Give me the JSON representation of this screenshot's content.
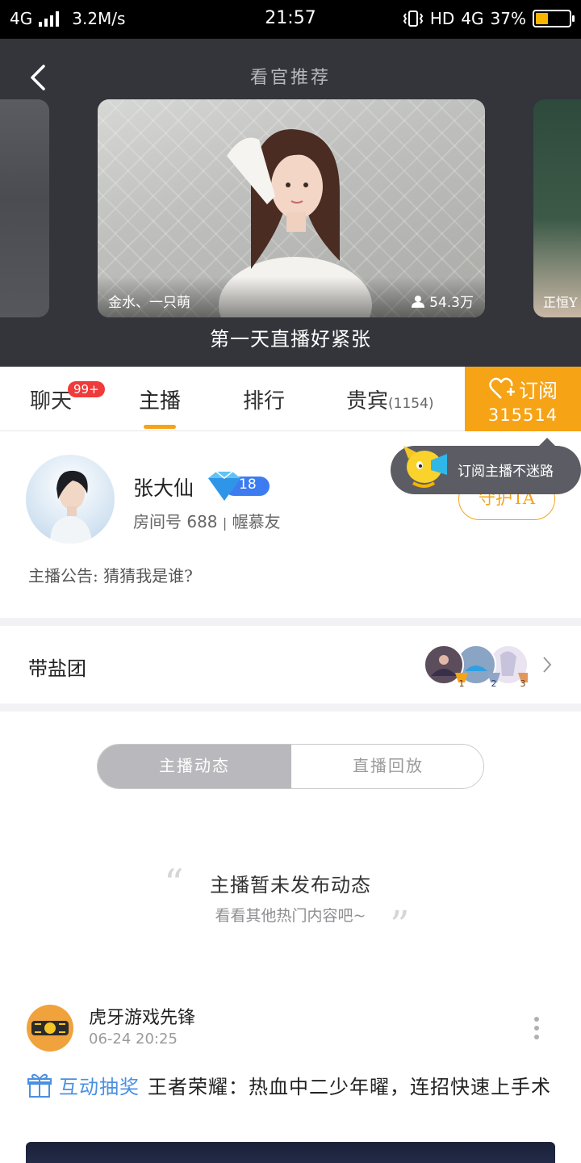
{
  "status_bar": {
    "network": "4G",
    "speed": "3.2M/s",
    "time": "21:57",
    "hd": "HD",
    "network_right": "4G",
    "battery_percent": "37%",
    "battery_level": 0.37,
    "battery_color": "#f6b400"
  },
  "header": {
    "title": "看官推荐",
    "back_icon": "chevron-left-icon"
  },
  "carousel": {
    "main": {
      "name": "金水、一只萌",
      "viewers": "54.3万",
      "caption": "第一天直播好紧张"
    },
    "right": {
      "name": "正恒Y"
    }
  },
  "tabs": {
    "chat": "聊天",
    "chat_badge": "99+",
    "streamer": "主播",
    "ranking": "排行",
    "vip": "贵宾",
    "vip_count": "(1154)",
    "accent_color": "#f6a316"
  },
  "subscribe": {
    "label": "订阅",
    "count": "315514"
  },
  "tooltip": {
    "text": "订阅主播不迷路"
  },
  "profile": {
    "name": "张大仙",
    "level": "18",
    "room_label": "房间号",
    "room_number": "688",
    "separator": "|",
    "room_tag": "幄慕友",
    "guard_button": "守护TA",
    "announcement": "主播公告: 猜猜我是谁?"
  },
  "fan_group": {
    "label": "带盐团",
    "ranks": [
      "1",
      "2",
      "3"
    ]
  },
  "segment": {
    "tab_posts": "主播动态",
    "tab_replay": "直播回放"
  },
  "empty_state": {
    "quote_open": "“",
    "quote_close": "”",
    "title": "主播暂未发布动态",
    "subtitle": "看看其他热门内容吧~"
  },
  "post": {
    "author": "虎牙游戏先锋",
    "time": "06-24 20:25",
    "tag": "互动抽奖",
    "title": "王者荣耀：热血中二少年曜，连招快速上手术"
  }
}
